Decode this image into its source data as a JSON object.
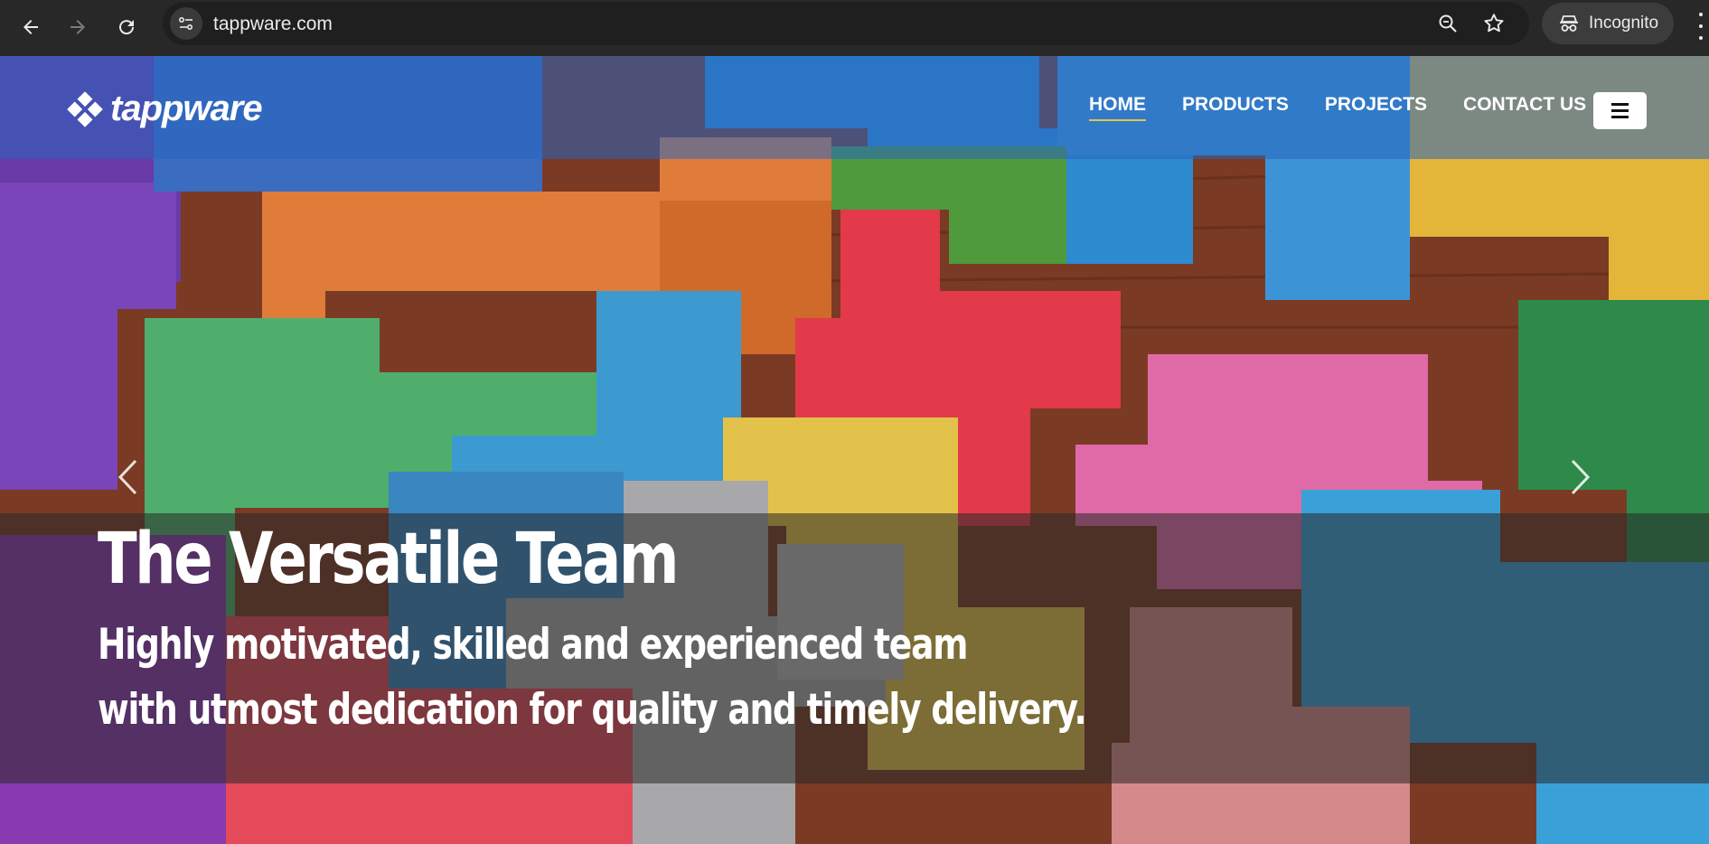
{
  "browser": {
    "url": "tappware.com",
    "incognito_label": "Incognito",
    "icons": [
      "back-arrow-icon",
      "forward-arrow-icon",
      "reload-icon",
      "site-info-icon",
      "zoom-icon",
      "star-icon",
      "incognito-icon",
      "more-options-icon"
    ]
  },
  "site": {
    "logo_text": "tappware",
    "nav": [
      {
        "label": "HOME",
        "active": true
      },
      {
        "label": "PRODUCTS",
        "active": false
      },
      {
        "label": "PROJECTS",
        "active": false
      },
      {
        "label": "CONTACT US",
        "active": false
      }
    ],
    "accent_color": "#e8c24a"
  },
  "hero": {
    "title": "The Versatile Team",
    "subtitle_line1": "Highly motivated, skilled and experienced team",
    "subtitle_line2": "with utmost dedication for quality and timely delivery."
  }
}
